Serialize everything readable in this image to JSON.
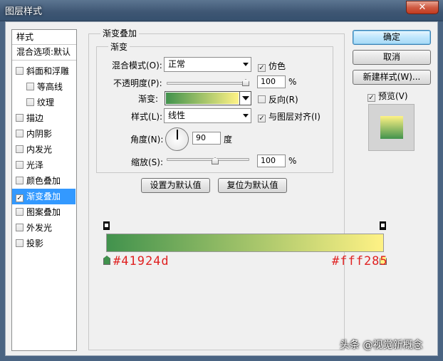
{
  "window": {
    "title": "图层样式",
    "close_label": "✕"
  },
  "sidebar": {
    "header": "样式",
    "blend_options": "混合选项:默认",
    "items": [
      {
        "label": "斜面和浮雕",
        "checked": false,
        "indent": false
      },
      {
        "label": "等高线",
        "checked": false,
        "indent": true
      },
      {
        "label": "纹理",
        "checked": false,
        "indent": true
      },
      {
        "label": "描边",
        "checked": false,
        "indent": false
      },
      {
        "label": "内阴影",
        "checked": false,
        "indent": false
      },
      {
        "label": "内发光",
        "checked": false,
        "indent": false
      },
      {
        "label": "光泽",
        "checked": false,
        "indent": false
      },
      {
        "label": "颜色叠加",
        "checked": false,
        "indent": false
      },
      {
        "label": "渐变叠加",
        "checked": true,
        "indent": false,
        "selected": true
      },
      {
        "label": "图案叠加",
        "checked": false,
        "indent": false
      },
      {
        "label": "外发光",
        "checked": false,
        "indent": false
      },
      {
        "label": "投影",
        "checked": false,
        "indent": false
      }
    ]
  },
  "panel": {
    "section_title": "渐变叠加",
    "subsection_title": "渐变",
    "blend_mode": {
      "label": "混合模式(O):",
      "value": "正常"
    },
    "dither": {
      "label": "仿色",
      "checked": true
    },
    "opacity": {
      "label": "不透明度(P):",
      "value": "100",
      "unit": "%",
      "level": 1.0
    },
    "gradient": {
      "label": "渐变:"
    },
    "reverse": {
      "label": "反向(R)",
      "checked": false
    },
    "style": {
      "label": "样式(L):",
      "value": "线性"
    },
    "align_with_layer": {
      "label": "与图层对齐(I)",
      "checked": true
    },
    "angle": {
      "label": "角度(N):",
      "value": "90",
      "unit": "度"
    },
    "scale": {
      "label": "缩放(S):",
      "value": "100",
      "unit": "%",
      "level": 0.5
    },
    "make_default": "设置为默认值",
    "reset_default": "复位为默认值"
  },
  "buttons": {
    "ok": "确定",
    "cancel": "取消",
    "new_style": "新建样式(W)...",
    "preview": {
      "label": "预览(V)",
      "checked": true
    }
  },
  "gradient_colors": {
    "start": "#41924d",
    "end": "#fff285"
  },
  "annotation": {
    "start_hex": "#41924d",
    "end_hex": "#fff285"
  },
  "watermark": "头条 @视觉新概念"
}
